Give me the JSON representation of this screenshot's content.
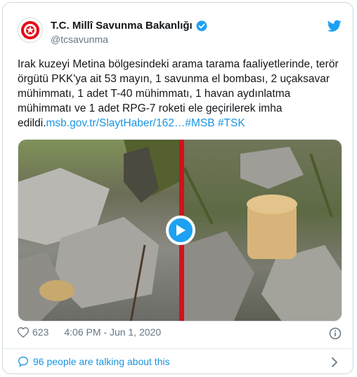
{
  "account": {
    "display_name": "T.C. Millî Savunma Bakanlığı",
    "handle": "@tcsavunma"
  },
  "tweet": {
    "text_parts": [
      "Irak kuzeyi Metina bölgesindeki arama tarama faaliyetlerinde, terör örgütü PKK'ya ait 53 mayın, 1 savunma el bombası, 2 uçaksavar mühimmatı, 1 adet T-40 mühimmatı, 1 havan aydınlatma mühimmatı ve 1 adet RPG-7 roketi ele geçirilerek imha edildi.",
      "msb.gov.tr/SlaytHaber/162…",
      "#MSB",
      "#TSK"
    ]
  },
  "meta": {
    "likes": "623",
    "timestamp": "4:06 PM - Jun 1, 2020"
  },
  "footer": {
    "talking": "96 people are talking about this"
  },
  "colors": {
    "link": "#1b95e0",
    "verified": "#1da1f2",
    "divider": "#d1121b"
  },
  "icons": [
    "msb-logo-icon",
    "verified-badge-icon",
    "twitter-bird-icon",
    "play-icon",
    "heart-icon",
    "info-icon",
    "comment-icon",
    "chevron-right-icon"
  ]
}
